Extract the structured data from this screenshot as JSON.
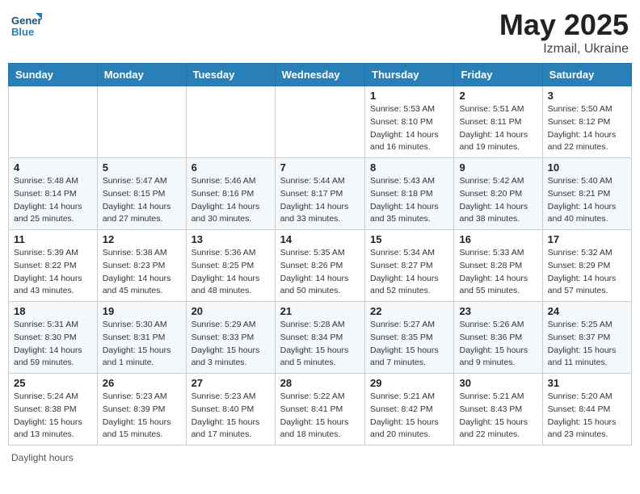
{
  "header": {
    "logo_general": "General",
    "logo_blue": "Blue",
    "month_year": "May 2025",
    "location": "Izmail, Ukraine"
  },
  "footer": {
    "daylight_hours": "Daylight hours"
  },
  "weekdays": [
    "Sunday",
    "Monday",
    "Tuesday",
    "Wednesday",
    "Thursday",
    "Friday",
    "Saturday"
  ],
  "weeks": [
    [
      {
        "day": "",
        "info": ""
      },
      {
        "day": "",
        "info": ""
      },
      {
        "day": "",
        "info": ""
      },
      {
        "day": "",
        "info": ""
      },
      {
        "day": "1",
        "info": "Sunrise: 5:53 AM\nSunset: 8:10 PM\nDaylight: 14 hours\nand 16 minutes."
      },
      {
        "day": "2",
        "info": "Sunrise: 5:51 AM\nSunset: 8:11 PM\nDaylight: 14 hours\nand 19 minutes."
      },
      {
        "day": "3",
        "info": "Sunrise: 5:50 AM\nSunset: 8:12 PM\nDaylight: 14 hours\nand 22 minutes."
      }
    ],
    [
      {
        "day": "4",
        "info": "Sunrise: 5:48 AM\nSunset: 8:14 PM\nDaylight: 14 hours\nand 25 minutes."
      },
      {
        "day": "5",
        "info": "Sunrise: 5:47 AM\nSunset: 8:15 PM\nDaylight: 14 hours\nand 27 minutes."
      },
      {
        "day": "6",
        "info": "Sunrise: 5:46 AM\nSunset: 8:16 PM\nDaylight: 14 hours\nand 30 minutes."
      },
      {
        "day": "7",
        "info": "Sunrise: 5:44 AM\nSunset: 8:17 PM\nDaylight: 14 hours\nand 33 minutes."
      },
      {
        "day": "8",
        "info": "Sunrise: 5:43 AM\nSunset: 8:18 PM\nDaylight: 14 hours\nand 35 minutes."
      },
      {
        "day": "9",
        "info": "Sunrise: 5:42 AM\nSunset: 8:20 PM\nDaylight: 14 hours\nand 38 minutes."
      },
      {
        "day": "10",
        "info": "Sunrise: 5:40 AM\nSunset: 8:21 PM\nDaylight: 14 hours\nand 40 minutes."
      }
    ],
    [
      {
        "day": "11",
        "info": "Sunrise: 5:39 AM\nSunset: 8:22 PM\nDaylight: 14 hours\nand 43 minutes."
      },
      {
        "day": "12",
        "info": "Sunrise: 5:38 AM\nSunset: 8:23 PM\nDaylight: 14 hours\nand 45 minutes."
      },
      {
        "day": "13",
        "info": "Sunrise: 5:36 AM\nSunset: 8:25 PM\nDaylight: 14 hours\nand 48 minutes."
      },
      {
        "day": "14",
        "info": "Sunrise: 5:35 AM\nSunset: 8:26 PM\nDaylight: 14 hours\nand 50 minutes."
      },
      {
        "day": "15",
        "info": "Sunrise: 5:34 AM\nSunset: 8:27 PM\nDaylight: 14 hours\nand 52 minutes."
      },
      {
        "day": "16",
        "info": "Sunrise: 5:33 AM\nSunset: 8:28 PM\nDaylight: 14 hours\nand 55 minutes."
      },
      {
        "day": "17",
        "info": "Sunrise: 5:32 AM\nSunset: 8:29 PM\nDaylight: 14 hours\nand 57 minutes."
      }
    ],
    [
      {
        "day": "18",
        "info": "Sunrise: 5:31 AM\nSunset: 8:30 PM\nDaylight: 14 hours\nand 59 minutes."
      },
      {
        "day": "19",
        "info": "Sunrise: 5:30 AM\nSunset: 8:31 PM\nDaylight: 15 hours\nand 1 minute."
      },
      {
        "day": "20",
        "info": "Sunrise: 5:29 AM\nSunset: 8:33 PM\nDaylight: 15 hours\nand 3 minutes."
      },
      {
        "day": "21",
        "info": "Sunrise: 5:28 AM\nSunset: 8:34 PM\nDaylight: 15 hours\nand 5 minutes."
      },
      {
        "day": "22",
        "info": "Sunrise: 5:27 AM\nSunset: 8:35 PM\nDaylight: 15 hours\nand 7 minutes."
      },
      {
        "day": "23",
        "info": "Sunrise: 5:26 AM\nSunset: 8:36 PM\nDaylight: 15 hours\nand 9 minutes."
      },
      {
        "day": "24",
        "info": "Sunrise: 5:25 AM\nSunset: 8:37 PM\nDaylight: 15 hours\nand 11 minutes."
      }
    ],
    [
      {
        "day": "25",
        "info": "Sunrise: 5:24 AM\nSunset: 8:38 PM\nDaylight: 15 hours\nand 13 minutes."
      },
      {
        "day": "26",
        "info": "Sunrise: 5:23 AM\nSunset: 8:39 PM\nDaylight: 15 hours\nand 15 minutes."
      },
      {
        "day": "27",
        "info": "Sunrise: 5:23 AM\nSunset: 8:40 PM\nDaylight: 15 hours\nand 17 minutes."
      },
      {
        "day": "28",
        "info": "Sunrise: 5:22 AM\nSunset: 8:41 PM\nDaylight: 15 hours\nand 18 minutes."
      },
      {
        "day": "29",
        "info": "Sunrise: 5:21 AM\nSunset: 8:42 PM\nDaylight: 15 hours\nand 20 minutes."
      },
      {
        "day": "30",
        "info": "Sunrise: 5:21 AM\nSunset: 8:43 PM\nDaylight: 15 hours\nand 22 minutes."
      },
      {
        "day": "31",
        "info": "Sunrise: 5:20 AM\nSunset: 8:44 PM\nDaylight: 15 hours\nand 23 minutes."
      }
    ]
  ]
}
